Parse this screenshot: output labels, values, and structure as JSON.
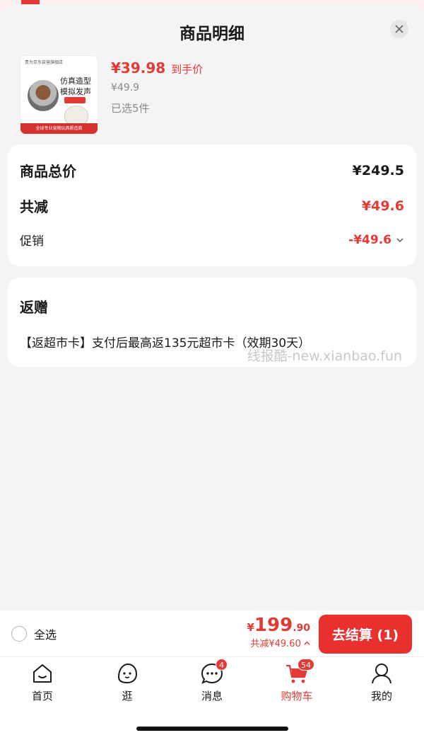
{
  "sheet": {
    "title": "商品明细"
  },
  "product": {
    "image_top_text": "贵为京东自营旗舰店",
    "image_text": "仿真造型 模拟发声",
    "image_bottom_text": "全球专业宠物玩具质造商",
    "price": "¥39.98",
    "price_tag": "到手价",
    "original_price": "¥49.9",
    "selected": "已选5件"
  },
  "summary": {
    "total_label": "商品总价",
    "total_value": "¥249.5",
    "reduce_label": "共减",
    "reduce_value": "¥49.6",
    "promo_label": "促销",
    "promo_value": "-¥49.6"
  },
  "gift": {
    "title": "返赠",
    "text": "【返超市卡】支付后最高返135元超市卡（效期30天）"
  },
  "watermark": "线报酷-new.xianbao.fun",
  "bottom": {
    "select_all": "全选",
    "currency": "¥",
    "amount_int": "199",
    "amount_dec": ".90",
    "reduce_text": "共减¥49.60",
    "checkout": "去结算 (1)"
  },
  "tabs": [
    {
      "label": "首页",
      "icon": "home-icon"
    },
    {
      "label": "逛",
      "icon": "browse-icon"
    },
    {
      "label": "消息",
      "icon": "message-icon",
      "badge": "4"
    },
    {
      "label": "购物车",
      "icon": "cart-icon",
      "badge": "54",
      "active": true
    },
    {
      "label": "我的",
      "icon": "profile-icon"
    }
  ],
  "colors": {
    "accent": "#e43a36",
    "checkout_bg": "#e8302f"
  }
}
